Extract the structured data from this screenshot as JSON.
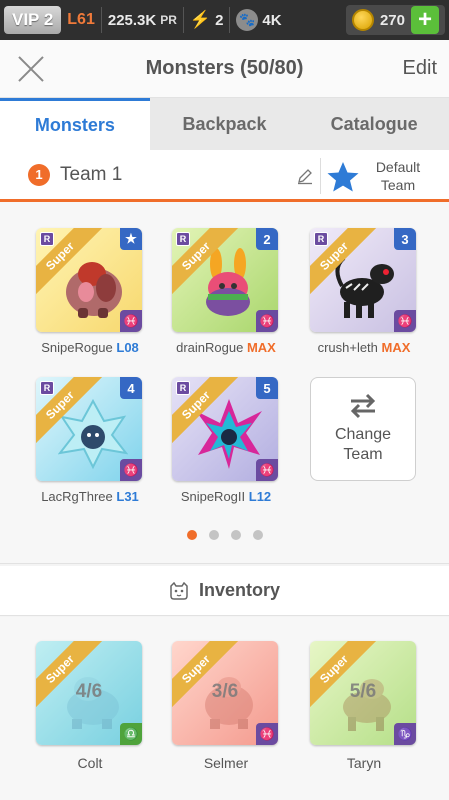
{
  "statusbar": {
    "vip": "VIP 2",
    "level": "L61",
    "power": "225.3K",
    "power_unit": "PR",
    "energy": "2",
    "paws": "4K",
    "coins": "270",
    "plus": "+"
  },
  "header": {
    "title": "Monsters (50/80)",
    "edit": "Edit"
  },
  "tabs": [
    "Monsters",
    "Backpack",
    "Catalogue"
  ],
  "team": {
    "number": "1",
    "name": "Team 1",
    "default_label_line1": "Default",
    "default_label_line2": "Team"
  },
  "team_monsters": [
    {
      "name": "SnipeRogue",
      "level": "L08",
      "slot": "★",
      "rarity": "Super",
      "badge": "R",
      "element": "♓",
      "color": "yellow"
    },
    {
      "name": "drainRogue",
      "level": "MAX",
      "slot": "2",
      "rarity": "Super",
      "badge": "R",
      "element": "♓",
      "color": "green"
    },
    {
      "name": "crush+leth",
      "level": "MAX",
      "slot": "3",
      "rarity": "Super",
      "badge": "R",
      "element": "♓",
      "color": "lilac"
    },
    {
      "name": "LacRgThree",
      "level": "L31",
      "slot": "4",
      "rarity": "Super",
      "badge": "R",
      "element": "♓",
      "color": "cyan"
    },
    {
      "name": "SnipeRogII",
      "level": "L12",
      "slot": "5",
      "rarity": "Super",
      "badge": "R",
      "element": "♓",
      "color": "lavender"
    }
  ],
  "change_team": {
    "line1": "Change",
    "line2": "Team"
  },
  "pagination": {
    "pages": 4,
    "current": 1
  },
  "inventory": {
    "label": "Inventory",
    "items": [
      {
        "name": "Colt",
        "fraction": "4/6",
        "rarity": "Super",
        "element": "♎"
      },
      {
        "name": "Selmer",
        "fraction": "3/6",
        "rarity": "Super",
        "element": "♓"
      },
      {
        "name": "Taryn",
        "fraction": "5/6",
        "rarity": "Super",
        "element": "♑"
      }
    ]
  },
  "colors": {
    "accent_blue": "#2e7bd6",
    "accent_orange": "#f06d2a",
    "ribbon_gold": "#e8b342",
    "statusbar_bg": "#2f2f2f",
    "plus_green": "#5bbf3a"
  }
}
